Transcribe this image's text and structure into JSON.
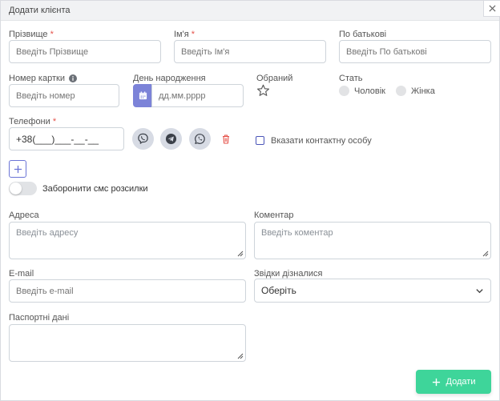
{
  "dialog": {
    "title": "Додати клієнта"
  },
  "form": {
    "surname": {
      "label": "Прізвище",
      "required_mark": "*",
      "placeholder": "Введіть Прізвище"
    },
    "name": {
      "label": "Ім'я",
      "required_mark": "*",
      "placeholder": "Введіть Ім'я"
    },
    "patronymic": {
      "label": "По батькові",
      "placeholder": "Введіть По батькові"
    },
    "card_number": {
      "label": "Номер картки",
      "placeholder": "Введіть номер"
    },
    "birthday": {
      "label": "День народження",
      "placeholder": "дд.мм.рррр"
    },
    "favorite": {
      "label": "Обраний"
    },
    "gender": {
      "label": "Стать",
      "male": "Чоловік",
      "female": "Жінка"
    },
    "phones": {
      "label": "Телефони",
      "required_mark": "*",
      "value": "+38(___)___-__-__"
    },
    "contact_person": {
      "label": "Вказати контактну особу"
    },
    "block_sms": {
      "label": "Заборонити смс розсилки"
    },
    "address": {
      "label": "Адреса",
      "placeholder": "Введіть адресу"
    },
    "comment": {
      "label": "Коментар",
      "placeholder": "Введіть коментар"
    },
    "email": {
      "label": "E-mail",
      "placeholder": "Введіть e-mail"
    },
    "source": {
      "label": "Звідки дізналися",
      "selected": "Оберіть"
    },
    "passport": {
      "label": "Паспортні дані"
    }
  },
  "actions": {
    "add_label": "Додати"
  },
  "colors": {
    "accent": "#7c83d8",
    "success": "#3ed59a",
    "danger": "#e5534b",
    "messenger_bg": "#d7dbe4"
  }
}
